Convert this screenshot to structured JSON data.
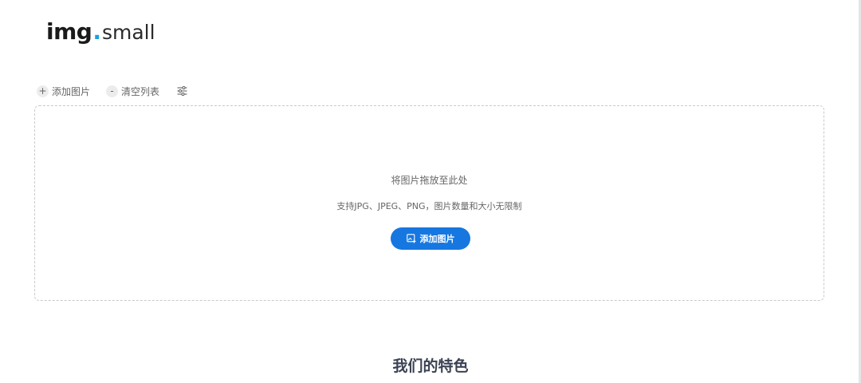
{
  "logo": {
    "strong": "img",
    "dot": ".",
    "light": "small",
    "accent_color": "#1aa0e0"
  },
  "toolbar": {
    "add_icon": "+",
    "add_label": "添加图片",
    "clear_icon": "-",
    "clear_label": "清空列表",
    "settings_icon": "sliders-icon"
  },
  "dropzone": {
    "title": "将图片拖放至此处",
    "subtitle": "支持JPG、JPEG、PNG，图片数量和大小无限制",
    "button_label": "添加图片",
    "button_icon": "image-add-icon",
    "button_color": "#1677e0"
  },
  "features": {
    "title": "我们的特色"
  }
}
